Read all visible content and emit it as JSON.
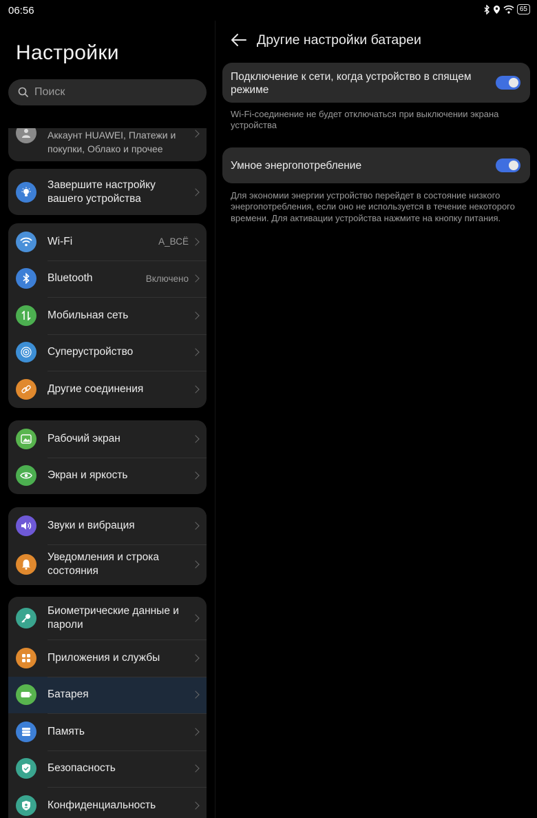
{
  "status": {
    "time": "06:56",
    "battery": "65"
  },
  "left": {
    "title": "Настройки",
    "search_placeholder": "Поиск",
    "account_text": "Аккаунт HUAWEI, Платежи и покупки, Облако и прочее",
    "setup_label": "Завершите настройку вашего устройства",
    "connections": [
      {
        "label": "Wi-Fi",
        "value": "A_ВСЁ"
      },
      {
        "label": "Bluetooth",
        "value": "Включено"
      },
      {
        "label": "Мобильная сеть"
      },
      {
        "label": "Суперустройство"
      },
      {
        "label": "Другие соединения"
      }
    ],
    "display": [
      {
        "label": "Рабочий экран"
      },
      {
        "label": "Экран и яркость"
      }
    ],
    "sound": [
      {
        "label": "Звуки и вибрация"
      },
      {
        "label": "Уведомления и строка состояния"
      }
    ],
    "system": [
      {
        "label": "Биометрические данные и пароли"
      },
      {
        "label": "Приложения и службы"
      },
      {
        "label": "Батарея"
      },
      {
        "label": "Память"
      },
      {
        "label": "Безопасность"
      },
      {
        "label": "Конфиденциальность"
      }
    ]
  },
  "right": {
    "title": "Другие настройки батареи",
    "option1": {
      "label": "Подключение к сети, когда устройство в спящем режиме",
      "enabled": true,
      "description": "Wi-Fi-соединение не будет отключаться при выключении экрана устройства"
    },
    "option2": {
      "label": "Умное энергопотребление",
      "enabled": true,
      "description": "Для экономии энергии устройство перейдет в состояние низкого энергопотребления, если оно не используется в течение некоторого времени. Для активации устройства нажмите на кнопку питания."
    }
  },
  "colors": {
    "accent": "#3f6fe0",
    "wifi": "#4a90d9",
    "bluetooth": "#3d7fd6",
    "mobile": "#4caf50",
    "superdevice": "#3d8fd6",
    "other_conn": "#e0892e",
    "home": "#58b44e",
    "display": "#4caf50",
    "sound": "#6e59d6",
    "notif": "#e0892e",
    "bio": "#3aa58f",
    "apps": "#e0892e",
    "battery": "#58b44e",
    "storage": "#3d7fd6",
    "security": "#3aa58f",
    "privacy": "#3aa58f"
  }
}
